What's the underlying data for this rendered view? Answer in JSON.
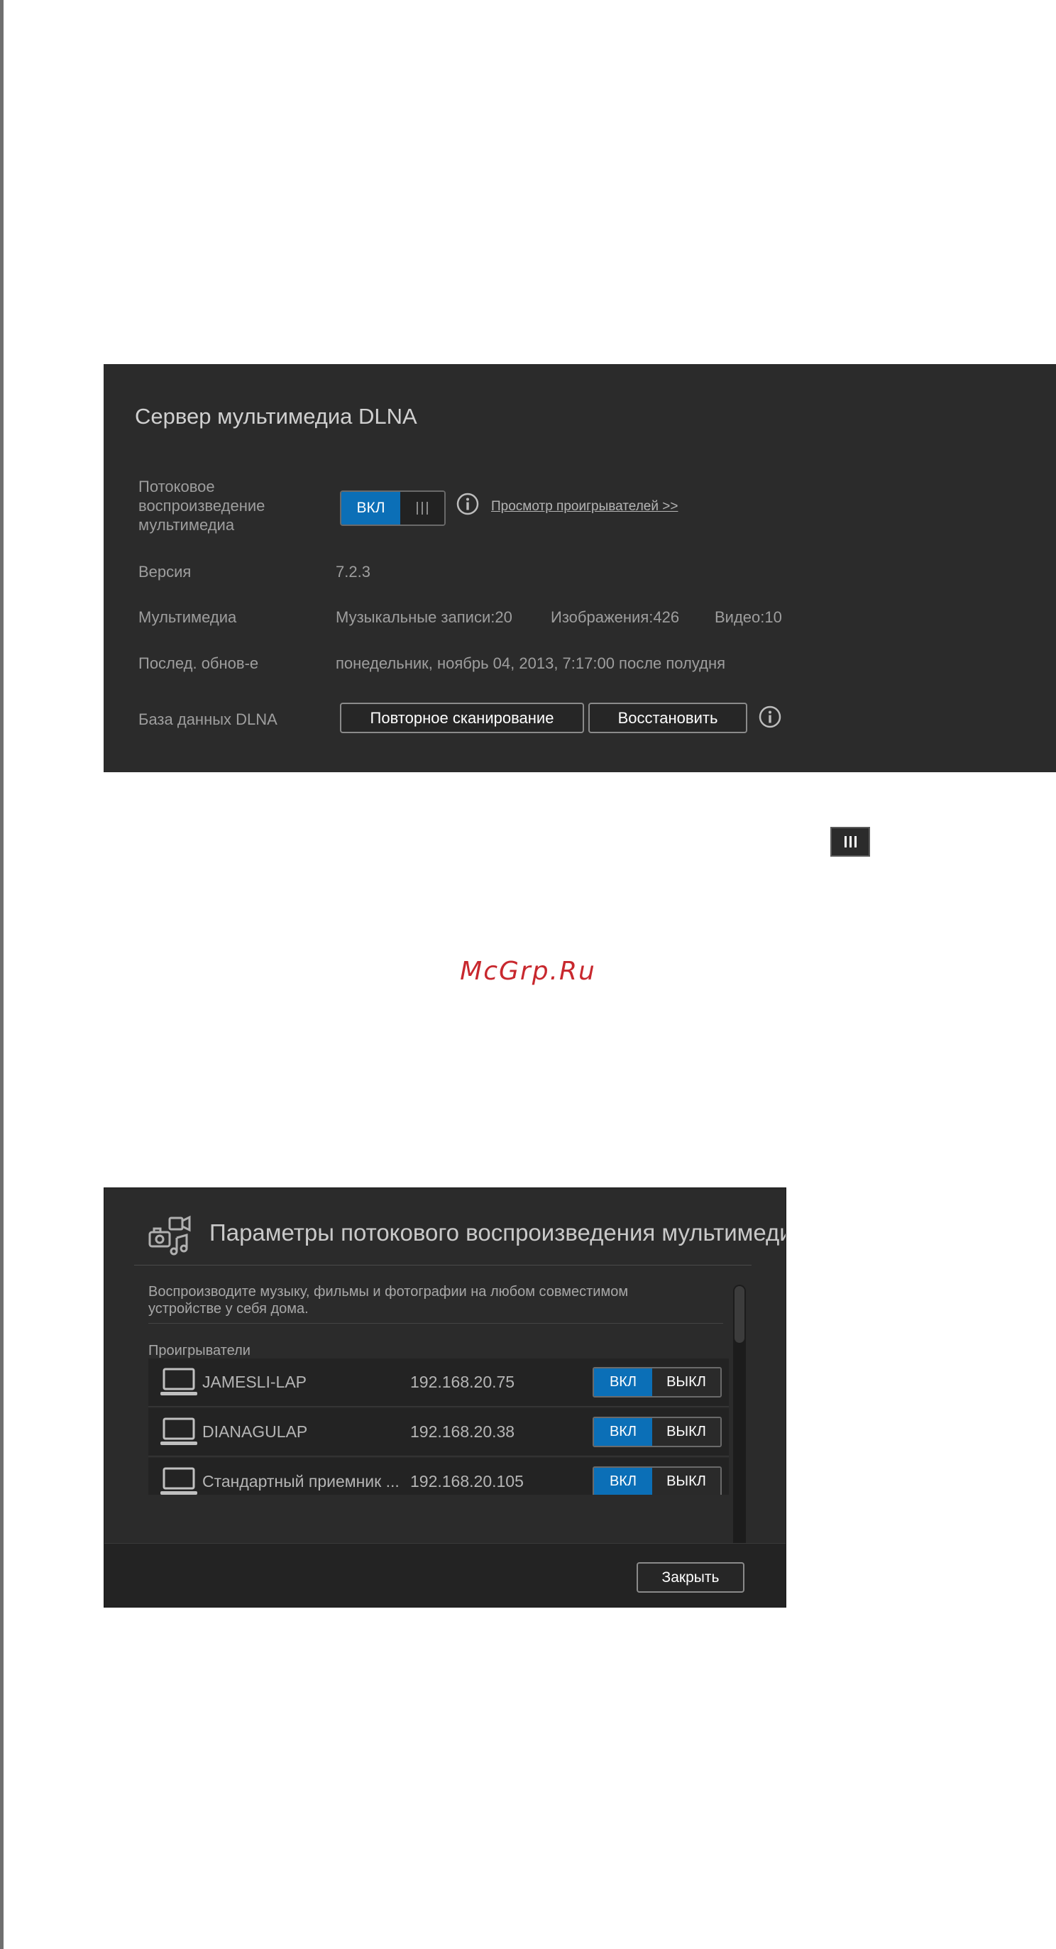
{
  "dlna": {
    "title": "Сервер мультимедиа DLNA",
    "streaming_label": "Потоковое воспроизведение мультимедиа",
    "streaming_toggle_on": "ВКЛ",
    "view_players_link": "Просмотр проигрывателей >>",
    "version_label": "Версия",
    "version_value": "7.2.3",
    "media_label": "Мультимедиа",
    "music_count": "Музыкальные записи:20",
    "images_count": "Изображения:426",
    "video_count": "Видео:10",
    "last_update_label": "Послед. обнов-е",
    "last_update_value": "понедельник, ноябрь 04, 2013, 7:17:00 после полудня",
    "db_label": "База данных DLNA",
    "rescan_button": "Повторное сканирование",
    "restore_button": "Восстановить"
  },
  "watermark": "McGrp.Ru",
  "streaming_settings": {
    "title": "Параметры потокового воспроизведения мультимеди",
    "description": "Воспроизводите музыку, фильмы и фотографии на любом совместимом устройстве у себя дома.",
    "players_label": "Проигрыватели",
    "on_label": "ВКЛ",
    "off_label": "ВЫКЛ",
    "players": [
      {
        "name": "JAMESLI-LAP",
        "ip": "192.168.20.75"
      },
      {
        "name": "DIANAGULAP",
        "ip": "192.168.20.38"
      },
      {
        "name": "Стандартный приемник ...",
        "ip": "192.168.20.105"
      },
      {
        "name": "",
        "ip": ""
      }
    ],
    "close_button": "Закрыть"
  },
  "colors": {
    "panel_bg": "#2b2b2b",
    "accent_blue": "#0b6fb7",
    "watermark_red": "#c8282e"
  }
}
